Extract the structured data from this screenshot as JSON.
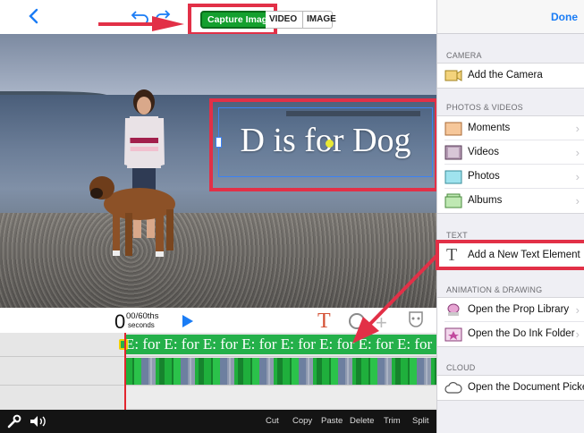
{
  "topbar": {
    "capture_label": "Capture Image",
    "mode_video": "VIDEO",
    "mode_image": "IMAGE"
  },
  "preview": {
    "text_element": "D is for Dog"
  },
  "transport": {
    "time_big": "0",
    "time_fraction": "00/60ths",
    "time_unit": "seconds"
  },
  "timeline": {
    "text_track": "E: for E: for E: for E: for E: for E: for E: for E: for"
  },
  "bottombar": {
    "actions": [
      "Cut",
      "Copy",
      "Paste",
      "Delete",
      "Trim",
      "Split"
    ]
  },
  "panel": {
    "done_label": "Done",
    "sections": [
      {
        "header": "CAMERA",
        "items": [
          {
            "label": "Add the Camera",
            "icon": "camera-icon",
            "chevron": false
          }
        ]
      },
      {
        "header": "PHOTOS & VIDEOS",
        "items": [
          {
            "label": "Moments",
            "icon": "moments-icon",
            "chevron": true
          },
          {
            "label": "Videos",
            "icon": "videos-icon",
            "chevron": true
          },
          {
            "label": "Photos",
            "icon": "photos-icon",
            "chevron": true
          },
          {
            "label": "Albums",
            "icon": "albums-icon",
            "chevron": true
          }
        ]
      },
      {
        "header": "TEXT",
        "items": [
          {
            "label": "Add a New Text Element",
            "icon": "text-icon",
            "chevron": false
          }
        ]
      },
      {
        "header": "ANIMATION & DRAWING",
        "items": [
          {
            "label": "Open the Prop Library",
            "icon": "prop-icon",
            "chevron": true
          },
          {
            "label": "Open the Do Ink Folder",
            "icon": "folder-icon",
            "chevron": true
          }
        ]
      },
      {
        "header": "CLOUD",
        "items": [
          {
            "label": "Open the Document Picker",
            "icon": "cloud-icon",
            "chevron": false
          }
        ]
      }
    ]
  },
  "colors": {
    "accent_blue": "#1a7cf5",
    "capture_green": "#14a02e",
    "highlight_red": "#e23047"
  }
}
